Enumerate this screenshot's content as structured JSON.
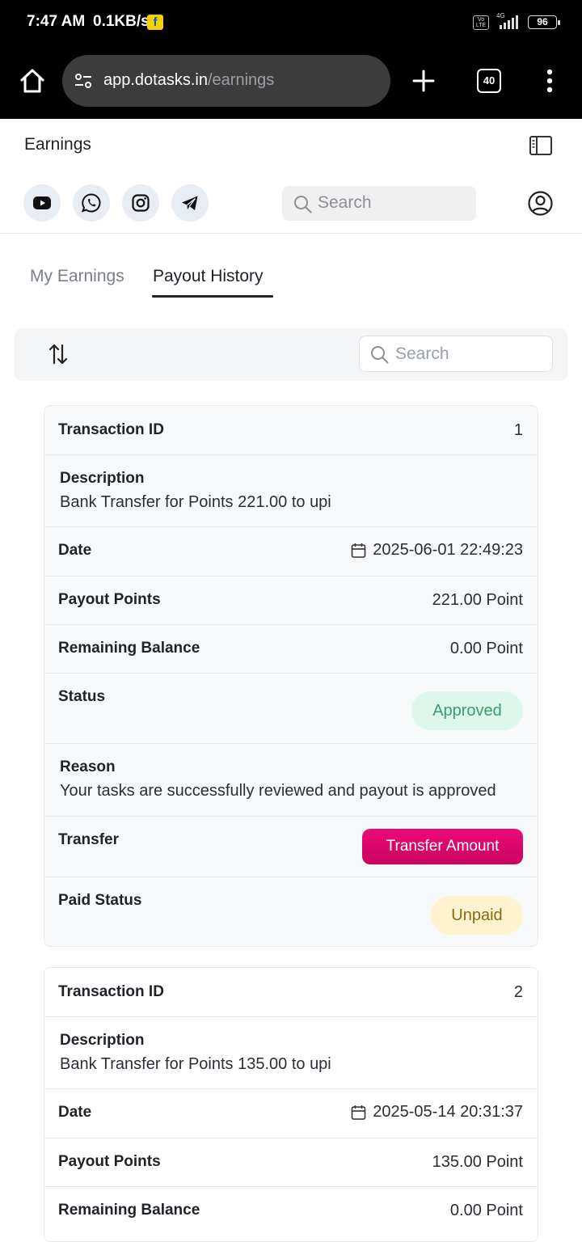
{
  "status_bar": {
    "time": "7:47 AM",
    "net_speed": "0.1KB/s",
    "volte": "Vo LTE",
    "network_type": "4G",
    "battery": "96"
  },
  "browser": {
    "url_host": "app.dotasks.in",
    "url_path": "/earnings",
    "tab_count": "40"
  },
  "header": {
    "title": "Earnings",
    "search_placeholder": "Search",
    "social_icons": [
      "youtube-icon",
      "whatsapp-icon",
      "instagram-icon",
      "telegram-icon"
    ]
  },
  "tabs": [
    {
      "label": "My Earnings",
      "active": false
    },
    {
      "label": "Payout History",
      "active": true
    }
  ],
  "toolbar": {
    "search_placeholder": "Search"
  },
  "labels": {
    "transaction_id": "Transaction ID",
    "description": "Description",
    "date": "Date",
    "payout_points": "Payout Points",
    "remaining_balance": "Remaining Balance",
    "status": "Status",
    "reason": "Reason",
    "transfer": "Transfer",
    "paid_status": "Paid Status",
    "transfer_button": "Transfer Amount"
  },
  "payouts": [
    {
      "transaction_id": "1",
      "description": "Bank Transfer for Points 221.00 to upi",
      "date": "2025-06-01 22:49:23",
      "payout_points": "221.00 Point",
      "remaining_balance": "0.00 Point",
      "status": "Approved",
      "reason": "Your tasks are successfully reviewed and payout is approved",
      "paid_status": "Unpaid"
    },
    {
      "transaction_id": "2",
      "description": "Bank Transfer for Points 135.00 to upi",
      "date": "2025-05-14 20:31:37",
      "payout_points": "135.00 Point",
      "remaining_balance": "0.00 Point"
    }
  ],
  "colors": {
    "accent_pink": "#e0096d",
    "approved_bg": "#def7ec",
    "approved_text": "#3a9c6e",
    "unpaid_bg": "#fdf3cf",
    "unpaid_text": "#8a6a12"
  }
}
